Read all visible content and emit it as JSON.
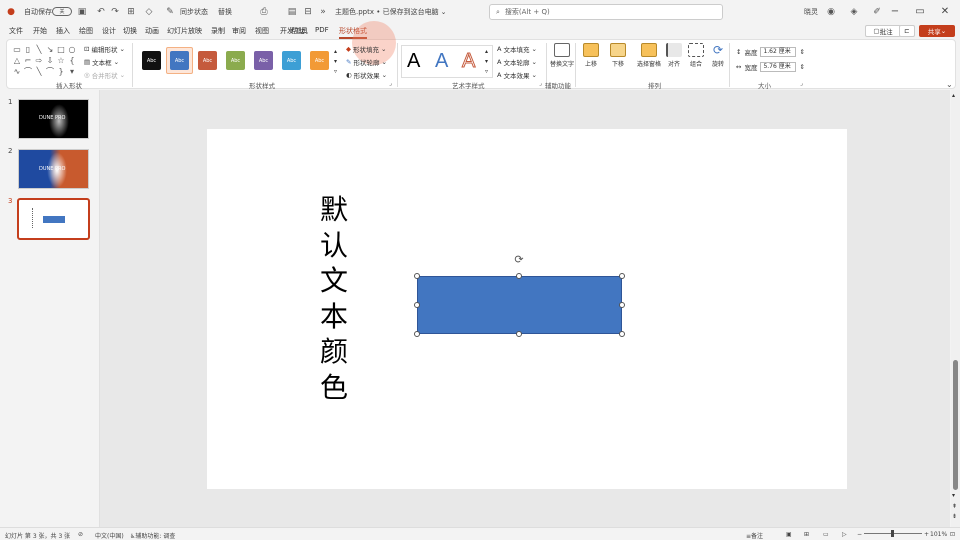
{
  "titlebar": {
    "autosave_label": "自动保存",
    "autosave_state": "关",
    "quick_a": "同步状态",
    "quick_b": "替换",
    "document_title": "主题色.pptx • 已保存到这台电脑",
    "search_placeholder": "搜索(Alt + Q)",
    "user": "晓灵"
  },
  "menu": {
    "tabs": [
      "文件",
      "开始",
      "插入",
      "绘图",
      "设计",
      "切换",
      "动画",
      "幻灯片放映",
      "录制",
      "审阅",
      "视图",
      "开发工具",
      "帮助",
      "PDF",
      "形状格式"
    ],
    "active": "形状格式",
    "annotate_label": "批注",
    "share_label": "共享"
  },
  "ribbon": {
    "insert_shapes": {
      "label": "插入形状",
      "edit_shape": "编辑形状",
      "text_box": "文本框",
      "merge_shapes": "合并形状"
    },
    "shape_styles": {
      "label": "形状样式",
      "swatch_text": "Abc",
      "swatches": [
        "#111111",
        "#4276c1",
        "#c55a3c",
        "#8bab4e",
        "#7a60a8",
        "#3d9fd5",
        "#f29a36"
      ],
      "fill": "形状填充",
      "outline": "形状轮廓",
      "effects": "形状效果"
    },
    "wordart": {
      "label": "艺术字样式",
      "glyph": "A",
      "text_fill": "文本填充",
      "text_outline": "文本轮廓",
      "text_effects": "文本效果"
    },
    "accessibility": {
      "label": "辅助功能",
      "alt_text": "替换文字"
    },
    "arrange": {
      "label": "排列",
      "bring_forward": "上移",
      "send_backward": "下移",
      "selection_pane": "选择窗格",
      "align": "对齐",
      "group": "组合",
      "rotate": "旋转"
    },
    "size": {
      "label": "大小",
      "height_label": "高度",
      "height_value": "1.62 厘米",
      "width_label": "宽度",
      "width_value": "5.76 厘米"
    }
  },
  "thumbnails": {
    "numbers": [
      "1",
      "2",
      "3"
    ],
    "slide1_text": "DUNE PRO",
    "slide2_text": "DUNE PRO"
  },
  "slide": {
    "vertical_text": [
      "默",
      "认",
      "文",
      "本",
      "颜",
      "色"
    ],
    "rect_color": "#4276c1"
  },
  "status": {
    "slide_info": "幻灯片 第 3 张，共 3 张",
    "language": "中文(中国)",
    "accessibility": "辅助功能: 调查",
    "notes": "备注",
    "zoom": "101%"
  }
}
